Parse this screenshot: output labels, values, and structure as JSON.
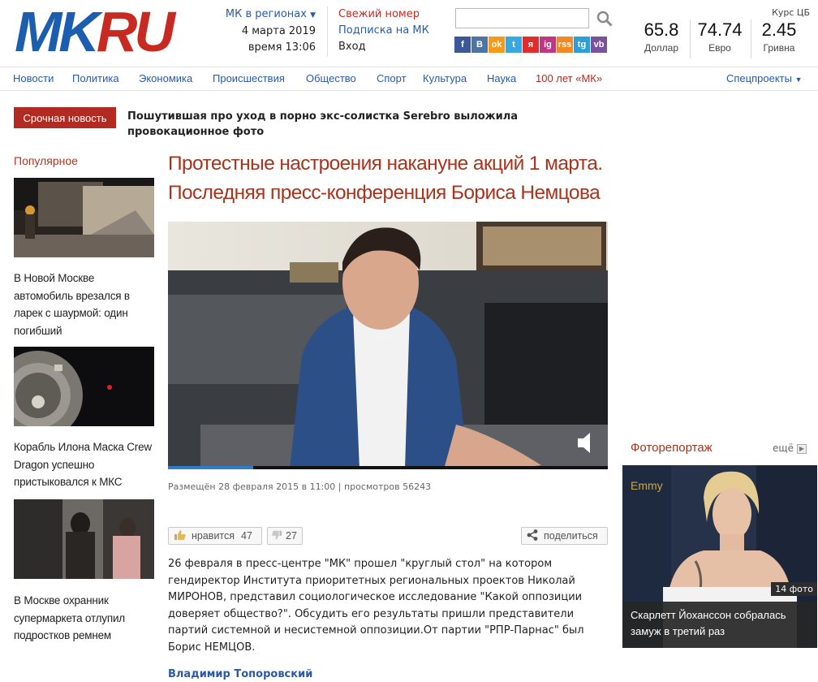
{
  "header": {
    "logo_mk": "MK",
    "logo_ru": "RU",
    "regions": "МК в регионах",
    "date": "4 марта 2019",
    "time": "время 13:06",
    "fresh_issue": "Свежий номер",
    "subscribe": "Подписка на МК",
    "login": "Вход",
    "search": {
      "placeholder": "",
      "icon": "search-icon"
    },
    "socials": [
      "f",
      "B",
      "ok",
      "t",
      "я",
      "ig",
      "rss",
      "tg",
      "vb"
    ],
    "rates_title": "Курс ЦБ",
    "rates": [
      {
        "value": "65.8",
        "name": "Доллар"
      },
      {
        "value": "74.74",
        "name": "Евро"
      },
      {
        "value": "2.45",
        "name": "Гривна"
      }
    ]
  },
  "nav": {
    "items": [
      "Новости",
      "Политика",
      "Экономика",
      "Происшествия",
      "Общество",
      "Спорт",
      "Культура",
      "Наука",
      "100 лет «МК»"
    ],
    "special": "Спецпроекты"
  },
  "breaking": {
    "label": "Срочная новость",
    "text": "Пошутившая про уход в порно экс-солистка Serebro выложила провокационное фото"
  },
  "popular": {
    "heading": "Популярное",
    "items": [
      {
        "title": "В Новой Москве автомобиль врезался в ларек с шаурмой: один погибший"
      },
      {
        "title": "Корабль Илона Маска Crew Dragon успешно пристыковался к МКС"
      },
      {
        "title": "В Москве охранник супермаркета отлупил подростков ремнем"
      }
    ]
  },
  "article": {
    "title": "Протестные настроения накануне акций 1 марта. Последняя пресс-конференция Бориса Немцова",
    "meta": "Размещён 28 февраля 2015 в 11:00 | просмотров 56243",
    "like_label": "нравится",
    "like_count": "47",
    "dislike_count": "27",
    "share_label": "поделиться",
    "body": "26 февраля в пресс-центре \"МК\" прошел \"круглый стол\" на котором гендиректор Института приоритетных региональных проектов Николай МИРОНОВ, представил социологическое исследование \"Какой оппозиции доверяет общество?\". Обсудить его результаты пришли представители партий системной и несистемной оппозиции.От партии \"РПР-Парнас\" был Борис НЕМЦОВ.",
    "author": "Владимир Топоровский"
  },
  "photoreport": {
    "heading": "Фоторепортаж",
    "more": "ещё",
    "count": "14 фото",
    "caption": "Скарлетт Йоханссон собралась замуж в третий раз"
  },
  "colors": {
    "brand_blue": "#1d5db0",
    "brand_red": "#c62a20",
    "headline": "#a8341d",
    "link": "#2a5aa6"
  }
}
